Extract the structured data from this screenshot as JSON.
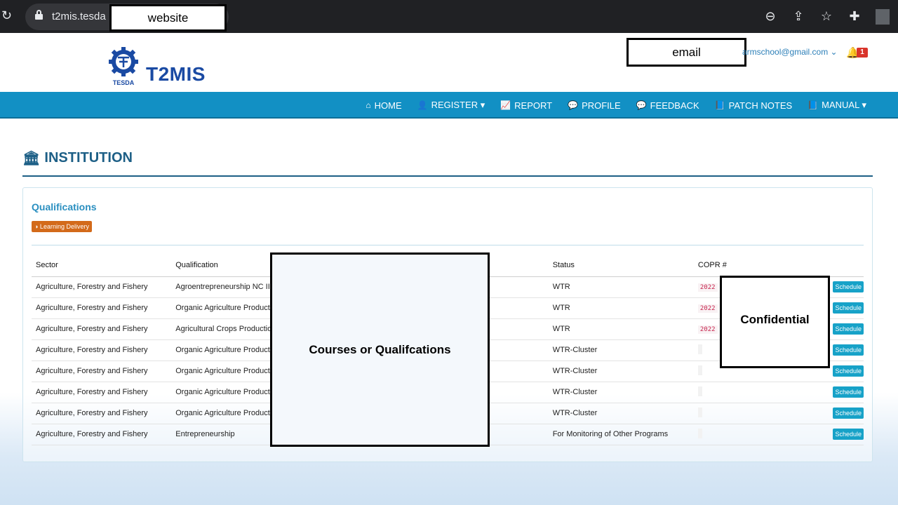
{
  "browser": {
    "url": "t2mis.tesda",
    "redacted_url_label": "website"
  },
  "header": {
    "app_title": "T2MIS",
    "logo_text": "TESDA",
    "redacted_email_label": "email",
    "user_email": "armschool@gmail.com ⌄",
    "notification_count": "1"
  },
  "nav": {
    "items": [
      {
        "icon": "home-icon",
        "glyph": "⌂",
        "label": "HOME"
      },
      {
        "icon": "user-plus-icon",
        "glyph": "👤",
        "label": "REGISTER ▾"
      },
      {
        "icon": "chart-line-icon",
        "glyph": "📈",
        "label": "REPORT"
      },
      {
        "icon": "comments-icon",
        "glyph": "💬",
        "label": "PROFILE"
      },
      {
        "icon": "comments-icon",
        "glyph": "💬",
        "label": "FEEDBACK"
      },
      {
        "icon": "book-icon",
        "glyph": "📘",
        "label": "PATCH NOTES"
      },
      {
        "icon": "book-icon",
        "glyph": "📘",
        "label": "MANUAL ▾"
      }
    ]
  },
  "page": {
    "title": "INSTITUTION",
    "panel_heading": "Qualifications",
    "badge": "◑ Learning Delivery"
  },
  "table": {
    "headers": [
      "Sector",
      "Qualification",
      "Status",
      "COPR #",
      ""
    ],
    "rows": [
      {
        "sector": "Agriculture, Forestry and Fishery",
        "qualification": "Agroentrepreneurship NC II -",
        "status": "WTR",
        "copr": "2022",
        "action": "Schedule"
      },
      {
        "sector": "Agriculture, Forestry and Fishery",
        "qualification": "Organic Agriculture Productio",
        "status": "WTR",
        "copr": "2022",
        "action": "Schedule"
      },
      {
        "sector": "Agriculture, Forestry and Fishery",
        "qualification": "Agricultural Crops Production",
        "status": "WTR",
        "copr": "2022",
        "action": "Schedule"
      },
      {
        "sector": "Agriculture, Forestry and Fishery",
        "qualification": "Organic Agriculture Productio",
        "status": "WTR-Cluster",
        "copr": "",
        "action": "Schedule"
      },
      {
        "sector": "Agriculture, Forestry and Fishery",
        "qualification": "Organic Agriculture Productio",
        "status": "WTR-Cluster",
        "copr": "",
        "action": "Schedule"
      },
      {
        "sector": "Agriculture, Forestry and Fishery",
        "qualification": "Organic Agriculture Productio",
        "status": "WTR-Cluster",
        "copr": "",
        "action": "Schedule"
      },
      {
        "sector": "Agriculture, Forestry and Fishery",
        "qualification": "Organic Agriculture Productio",
        "status": "WTR-Cluster",
        "copr": "",
        "action": "Schedule"
      },
      {
        "sector": "Agriculture, Forestry and Fishery",
        "qualification": "Entrepreneurship",
        "status": "For Monitoring of Other Programs",
        "copr": "",
        "action": "Schedule"
      }
    ]
  },
  "redactions": {
    "courses_label": "Courses or Qualifcations",
    "confidential_label": "Confidential"
  },
  "colors": {
    "navbar": "#1290c4",
    "title": "#1d5f86",
    "badge": "#d36a1a",
    "schedule_button": "#17a2c8"
  }
}
